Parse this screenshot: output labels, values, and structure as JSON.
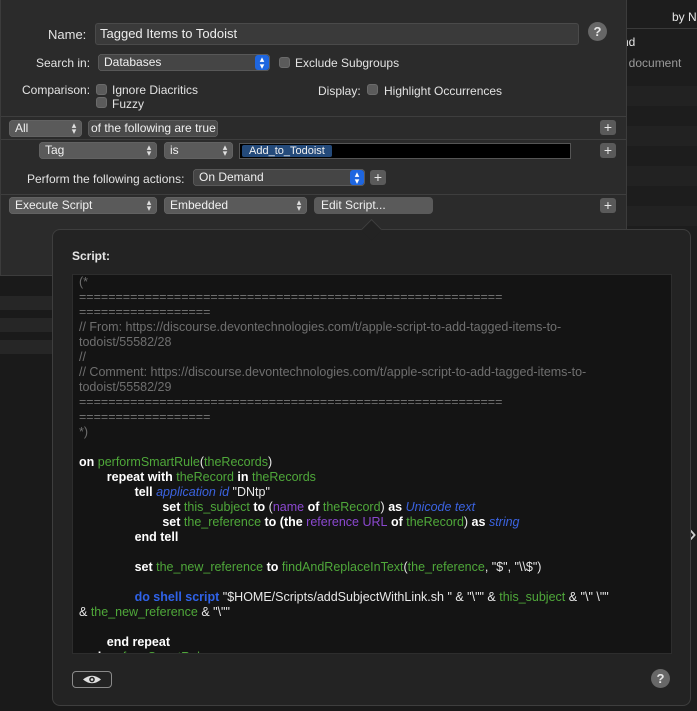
{
  "background_window": {
    "header_text": "by N",
    "column_label": "nd",
    "row_text": "xt document"
  },
  "dialog": {
    "name_label": "Name:",
    "name_value": "Tagged Items to Todoist",
    "search_in_label": "Search in:",
    "search_in_value": "Databases",
    "exclude_subgroups_label": "Exclude Subgroups",
    "comparison_label": "Comparison:",
    "ignore_diacritics_label": "Ignore Diacritics",
    "fuzzy_label": "Fuzzy",
    "display_label": "Display:",
    "highlight_occurrences_label": "Highlight Occurrences",
    "match_mode": "All",
    "match_suffix": "of the following are true",
    "criterion_field": "Tag",
    "criterion_operator": "is",
    "criterion_value": "Add_to_Todoist",
    "perform_label": "Perform the following actions:",
    "perform_value": "On Demand",
    "action_type": "Execute Script",
    "action_source": "Embedded",
    "edit_script_label": "Edit Script...",
    "help": "?",
    "plus": "+"
  },
  "popover": {
    "title": "Script:",
    "help": "?",
    "code_lines": [
      [
        {
          "t": "(*",
          "c": "comment"
        }
      ],
      [
        {
          "t": "==========================================================",
          "c": "comment"
        }
      ],
      [
        {
          "t": "==================",
          "c": "comment"
        }
      ],
      [
        {
          "t": "// From: https://discourse.devontechnologies.com/t/apple-script-to-add-tagged-items-to-",
          "c": "comment"
        }
      ],
      [
        {
          "t": "todoist/55582/28",
          "c": "comment"
        }
      ],
      [
        {
          "t": "//",
          "c": "comment"
        }
      ],
      [
        {
          "t": "// Comment: https://discourse.devontechnologies.com/t/apple-script-to-add-tagged-items-to-",
          "c": "comment"
        }
      ],
      [
        {
          "t": "todoist/55582/29",
          "c": "comment"
        }
      ],
      [
        {
          "t": "==========================================================",
          "c": "comment"
        }
      ],
      [
        {
          "t": "==================",
          "c": "comment"
        }
      ],
      [
        {
          "t": "*)",
          "c": "comment"
        }
      ],
      [],
      [
        {
          "t": "on ",
          "c": "kw"
        },
        {
          "t": "performSmartRule",
          "c": "var"
        },
        {
          "t": "(",
          "c": "str"
        },
        {
          "t": "theRecords",
          "c": "var"
        },
        {
          "t": ")",
          "c": "str"
        }
      ],
      [
        {
          "t": "        repeat with ",
          "c": "kw"
        },
        {
          "t": "theRecord",
          "c": "var"
        },
        {
          "t": " in ",
          "c": "kw"
        },
        {
          "t": "theRecords",
          "c": "var"
        }
      ],
      [
        {
          "t": "                tell ",
          "c": "kw"
        },
        {
          "t": "application id",
          "c": "cls"
        },
        {
          "t": " \"DNtp\"",
          "c": "str"
        }
      ],
      [
        {
          "t": "                        set ",
          "c": "kw"
        },
        {
          "t": "this_subject",
          "c": "var"
        },
        {
          "t": " to ",
          "c": "kw"
        },
        {
          "t": "(",
          "c": "str"
        },
        {
          "t": "name",
          "c": "prop"
        },
        {
          "t": " of ",
          "c": "kw"
        },
        {
          "t": "theRecord",
          "c": "var"
        },
        {
          "t": ") ",
          "c": "str"
        },
        {
          "t": "as ",
          "c": "kw"
        },
        {
          "t": "Unicode text",
          "c": "cls"
        }
      ],
      [
        {
          "t": "                        set ",
          "c": "kw"
        },
        {
          "t": "the_reference",
          "c": "var"
        },
        {
          "t": " to ",
          "c": "kw"
        },
        {
          "t": "(the ",
          "c": "kw"
        },
        {
          "t": "reference URL",
          "c": "prop"
        },
        {
          "t": " of ",
          "c": "kw"
        },
        {
          "t": "theRecord",
          "c": "var"
        },
        {
          "t": ") ",
          "c": "str"
        },
        {
          "t": "as ",
          "c": "kw"
        },
        {
          "t": "string",
          "c": "cls"
        }
      ],
      [
        {
          "t": "                end tell",
          "c": "kw"
        }
      ],
      [],
      [
        {
          "t": "                set ",
          "c": "kw"
        },
        {
          "t": "the_new_reference",
          "c": "var"
        },
        {
          "t": " to ",
          "c": "kw"
        },
        {
          "t": "findAndReplaceInText",
          "c": "var"
        },
        {
          "t": "(",
          "c": "str"
        },
        {
          "t": "the_reference",
          "c": "var"
        },
        {
          "t": ", \"$\", \"\\\\$\")",
          "c": "str"
        }
      ],
      [],
      [
        {
          "t": "                do shell script",
          "c": "cmd"
        },
        {
          "t": " \"$HOME/Scripts/addSubjectWithLink.sh \" & \"\\\"\" & ",
          "c": "str"
        },
        {
          "t": "this_subject",
          "c": "var"
        },
        {
          "t": " & \"\\\" \\\"\"",
          "c": "str"
        }
      ],
      [
        {
          "t": "& ",
          "c": "str"
        },
        {
          "t": "the_new_reference",
          "c": "var"
        },
        {
          "t": " & \"\\\"\"",
          "c": "str"
        }
      ],
      [],
      [
        {
          "t": "        end repeat",
          "c": "kw"
        }
      ],
      [
        {
          "t": "end ",
          "c": "kw"
        },
        {
          "t": "performSmartRule",
          "c": "var"
        }
      ]
    ]
  }
}
